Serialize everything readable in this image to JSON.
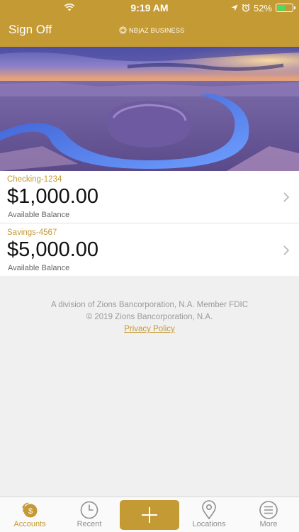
{
  "status_bar": {
    "time": "9:19 AM",
    "battery": "52%",
    "battery_level": 0.52,
    "icons": [
      "wifi-icon",
      "location-arrow-icon",
      "alarm-icon",
      "battery-icon"
    ]
  },
  "nav": {
    "sign_off": "Sign Off",
    "brand": "NB|AZ BUSINESS"
  },
  "hero": {
    "image": "canyon-river-bend-sunset"
  },
  "accounts": [
    {
      "name": "Checking-1234",
      "balance": "$1,000.00",
      "balance_label": "Available Balance"
    },
    {
      "name": "Savings-4567",
      "balance": "$5,000.00",
      "balance_label": "Available Balance"
    }
  ],
  "footer": {
    "line1": "A division of Zions Bancorporation, N.A. Member FDIC",
    "line2": "© 2019 Zions Bancorporation, N.A.",
    "privacy": "Privacy Policy"
  },
  "tabbar": {
    "accounts": "Accounts",
    "recent": "Recent",
    "locations": "Locations",
    "more": "More",
    "active": "Accounts"
  },
  "colors": {
    "brand_gold": "#c49a34",
    "background": "#f0f0f0",
    "battery_green": "#4cd964"
  }
}
